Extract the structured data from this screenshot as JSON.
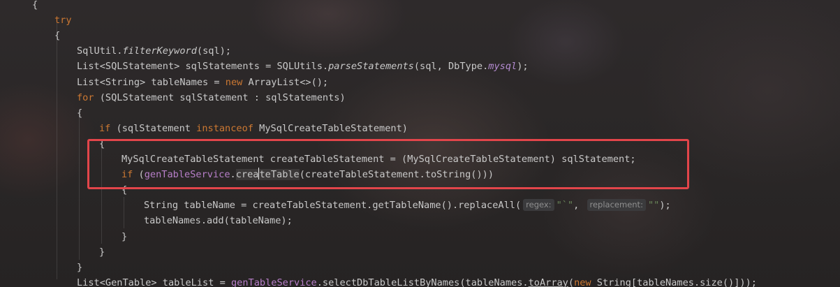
{
  "editor": {
    "lines": [
      {
        "indent": 0,
        "parts": [
          [
            "{",
            ""
          ]
        ]
      },
      {
        "indent": 1,
        "parts": [
          [
            "try",
            "kw"
          ]
        ]
      },
      {
        "indent": 1,
        "parts": [
          [
            "{",
            ""
          ]
        ]
      },
      {
        "indent": 2,
        "parts": [
          [
            "SqlUtil.",
            ""
          ],
          [
            "filterKeyword",
            "it"
          ],
          [
            "(sql);",
            ""
          ]
        ]
      },
      {
        "indent": 2,
        "parts": [
          [
            "List<SQLStatement> sqlStatements = SQLUtils.",
            ""
          ],
          [
            "parseStatements",
            "it"
          ],
          [
            "(sql, DbType.",
            ""
          ],
          [
            "mysql",
            "fld"
          ],
          [
            ");",
            ""
          ]
        ]
      },
      {
        "indent": 2,
        "parts": [
          [
            "List<String> tableNames = ",
            ""
          ],
          [
            "new",
            "kw"
          ],
          [
            " ArrayList<>();",
            ""
          ]
        ]
      },
      {
        "indent": 2,
        "parts": [
          [
            "for",
            "kw"
          ],
          [
            " (SQLStatement sqlStatement : sqlStatements)",
            ""
          ]
        ]
      },
      {
        "indent": 2,
        "parts": [
          [
            "{",
            ""
          ]
        ]
      },
      {
        "indent": 3,
        "parts": [
          [
            "if",
            "kw"
          ],
          [
            " (sqlStatement ",
            ""
          ],
          [
            "instanceof",
            "kw"
          ],
          [
            " MySqlCreateTableStatement)",
            ""
          ]
        ]
      },
      {
        "indent": 3,
        "parts": [
          [
            "{",
            ""
          ]
        ]
      },
      {
        "indent": 4,
        "parts": [
          [
            "MySqlCreateTableStatement createTableStatement = (MySqlCreateTableStatement) sqlStatement;",
            ""
          ]
        ]
      },
      {
        "indent": 4,
        "parts": [
          [
            "if",
            "kw"
          ],
          [
            " (",
            ""
          ],
          [
            "genTableService",
            "svc"
          ],
          [
            ".",
            ""
          ],
          [
            "crea",
            "tokhl"
          ],
          [
            "|",
            "caret"
          ],
          [
            "teTable",
            "tokhl"
          ],
          [
            "(createTableStatement.toString()))",
            ""
          ]
        ]
      },
      {
        "indent": 4,
        "parts": [
          [
            "{",
            ""
          ]
        ]
      },
      {
        "indent": 5,
        "parts": [
          [
            "String tableName = createTableStatement.getTableName().replaceAll(",
            ""
          ],
          [
            "regex:",
            "hint"
          ],
          [
            "\"`\"",
            "str"
          ],
          [
            ", ",
            ""
          ],
          [
            "replacement:",
            "hint"
          ],
          [
            "\"\"",
            "str"
          ],
          [
            ");",
            ""
          ]
        ]
      },
      {
        "indent": 5,
        "parts": [
          [
            "tableNames.add(tableName);",
            ""
          ]
        ]
      },
      {
        "indent": 4,
        "parts": [
          [
            "}",
            ""
          ]
        ]
      },
      {
        "indent": 3,
        "parts": [
          [
            "}",
            ""
          ]
        ]
      },
      {
        "indent": 2,
        "parts": [
          [
            "}",
            ""
          ]
        ]
      },
      {
        "indent": 2,
        "parts": [
          [
            "List<GenTable> tableList = ",
            ""
          ],
          [
            "genTableService",
            "svc"
          ],
          [
            ".selectDbTableListByNames(tableNames.",
            ""
          ],
          [
            "toArray",
            "under"
          ],
          [
            "(",
            ""
          ],
          [
            "new",
            "kw"
          ],
          [
            " String[tableNames.size()]));",
            ""
          ]
        ]
      }
    ]
  },
  "highlight": {
    "label": "selection-highlight",
    "color": "#e2454a"
  }
}
